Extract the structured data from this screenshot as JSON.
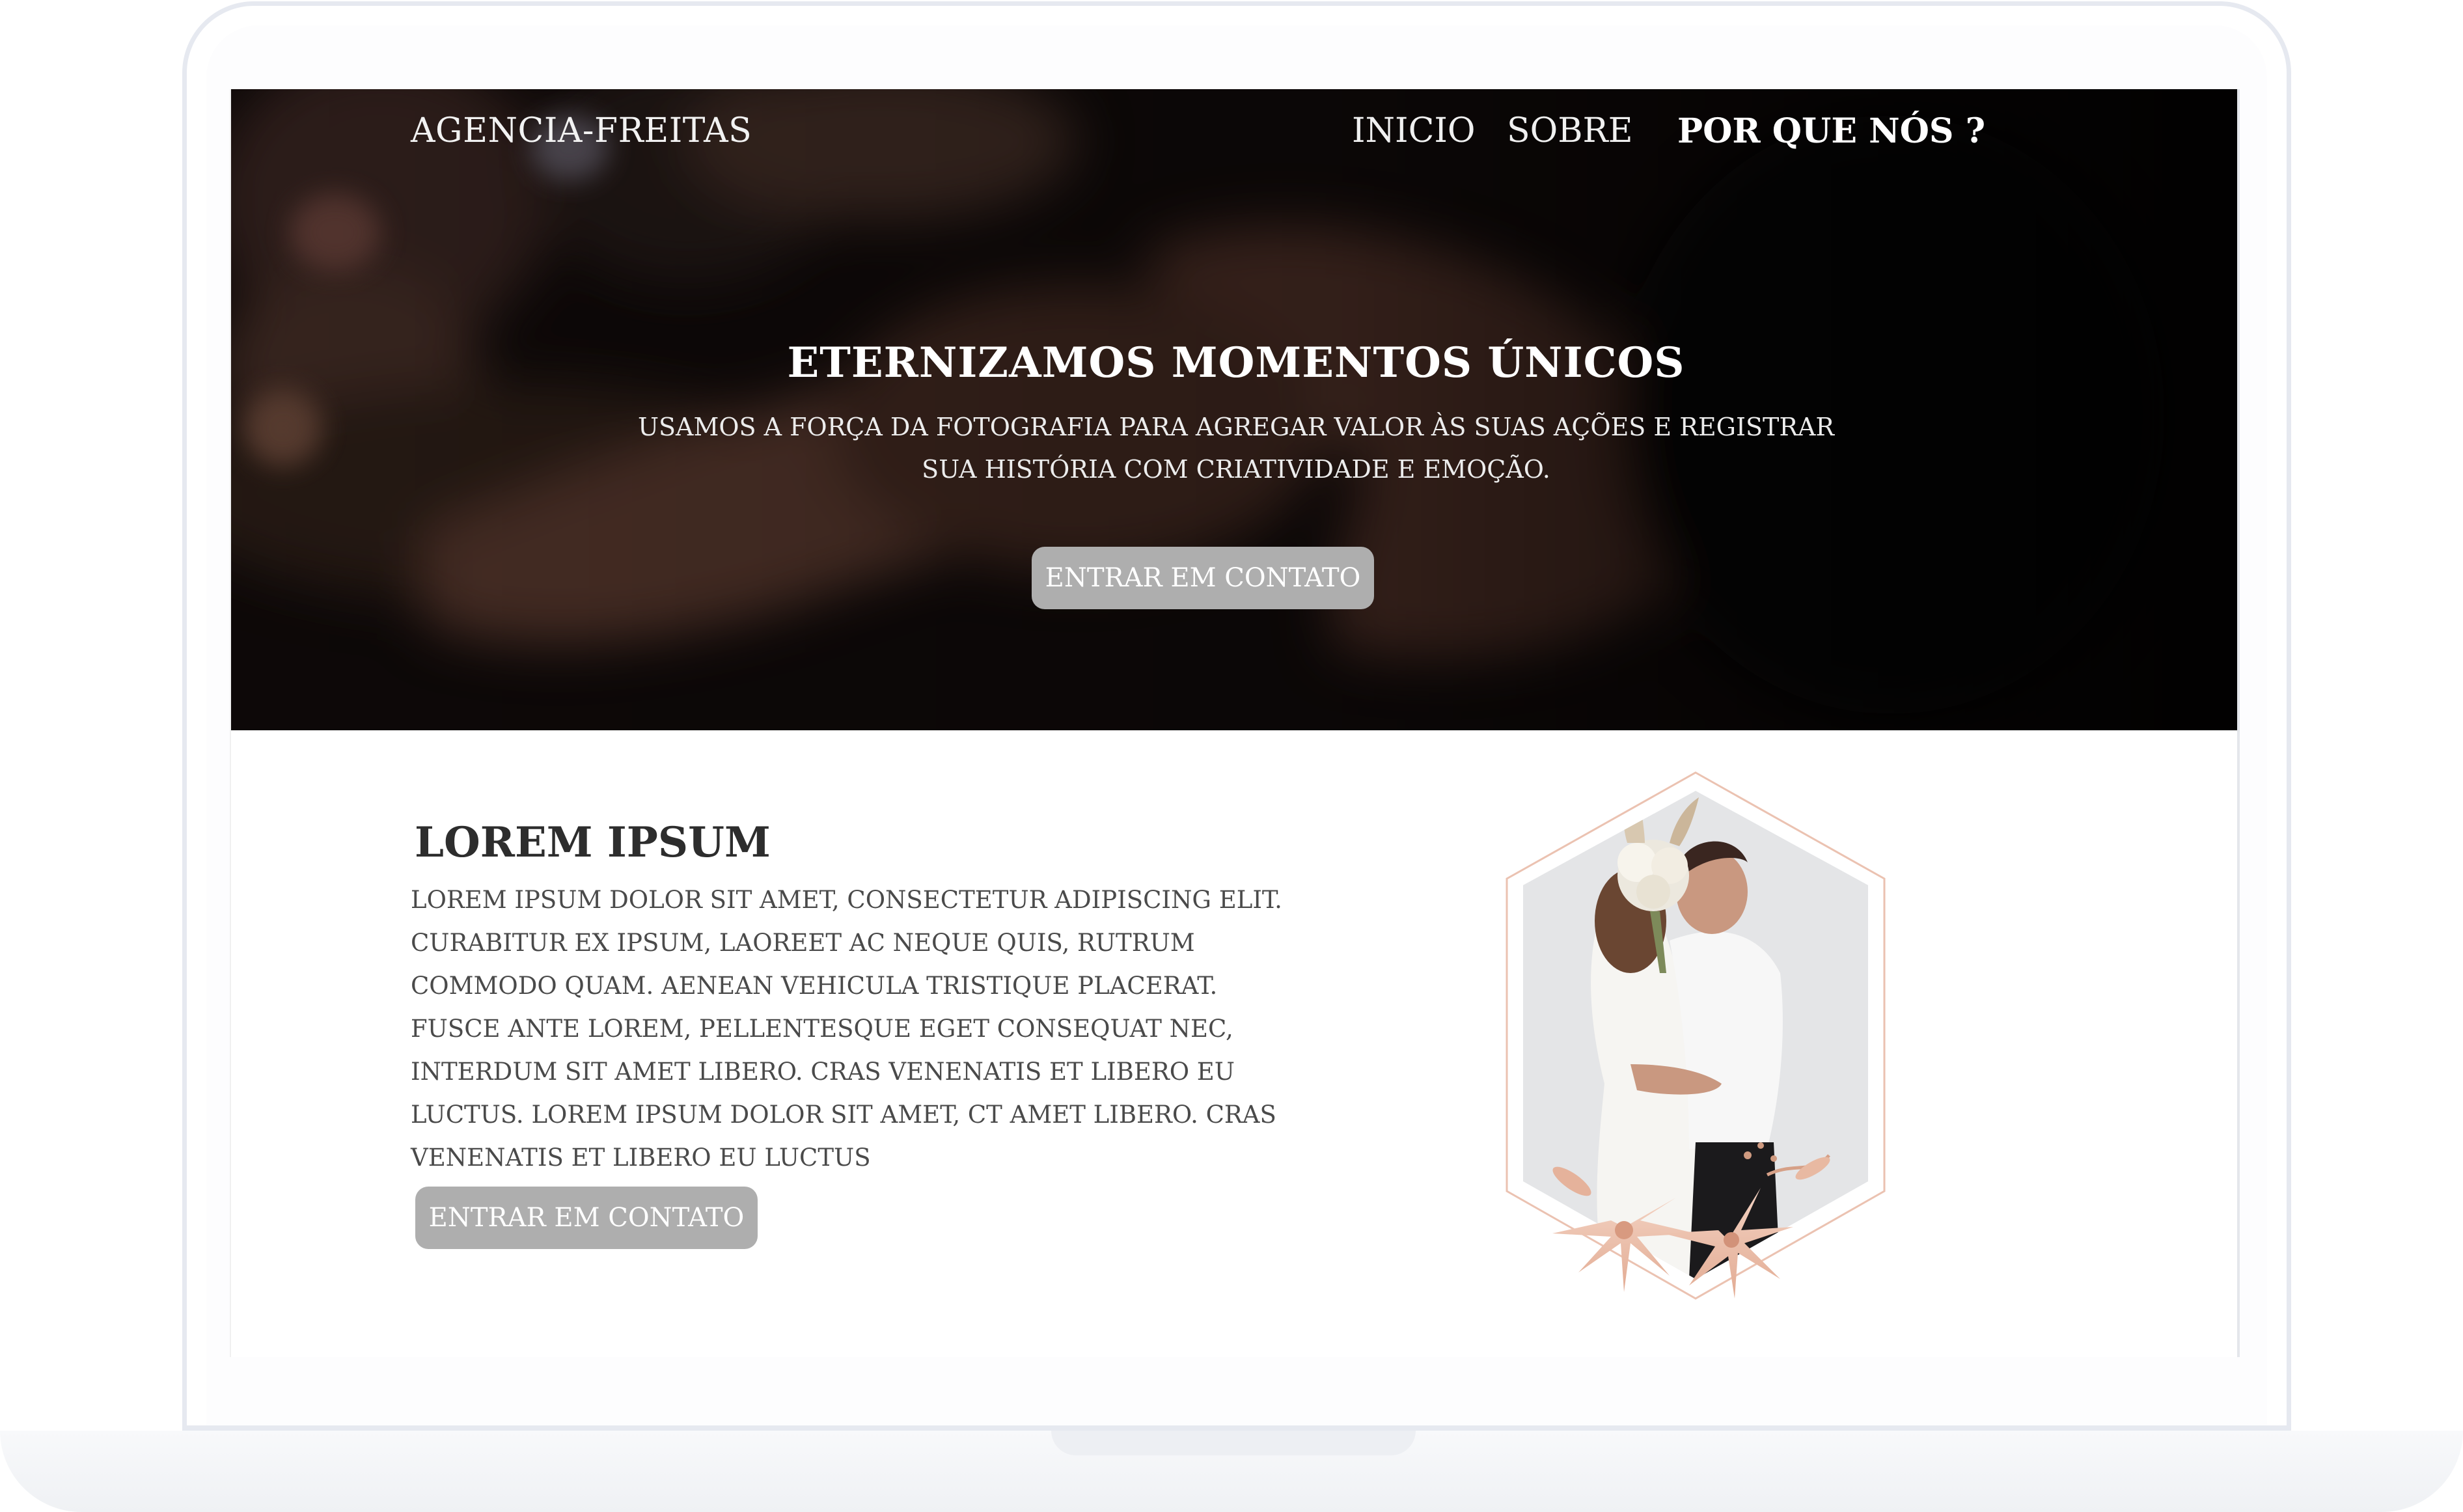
{
  "colors": {
    "hero_overlay": "#0a0706",
    "button_bg": "#aeaeae",
    "button_text": "#ffffff",
    "heading": "#2d2d2d",
    "body_text": "#4a4a4a",
    "accent_line": "#e8b9a6",
    "laptop_frame": "#e6e9f0"
  },
  "header": {
    "brand": "AGENCIA-FREITAS",
    "nav": [
      "INICIO",
      "SOBRE",
      "POR QUE NÓS ?"
    ]
  },
  "hero": {
    "title": "ETERNIZAMOS MOMENTOS ÚNICOS",
    "subtitle": "USAMOS A FORÇA DA FOTOGRAFIA PARA AGREGAR VALOR ÀS SUAS AÇÕES E REGISTRAR SUA HISTÓRIA COM CRIATIVIDADE E EMOÇÃO.",
    "button": "ENTRAR EM CONTATO"
  },
  "about": {
    "title": "LOREM IPSUM",
    "text": "LOREM IPSUM DOLOR SIT AMET, CONSECTETUR ADIPISCING ELIT. CURABITUR EX IPSUM, LAOREET AC NEQUE QUIS, RUTRUM COMMODO QUAM. AENEAN VEHICULA TRISTIQUE PLACERAT. FUSCE ANTE LOREM, PELLENTESQUE EGET CONSEQUAT NEC, INTERDUM SIT AMET LIBERO. CRAS VENENATIS ET LIBERO EU LUCTUS. LOREM IPSUM DOLOR SIT AMET, CT AMET LIBERO. CRAS VENENATIS ET LIBERO EU LUCTUS",
    "button": "ENTRAR EM CONTATO"
  },
  "icons": [
    "wedding-hero-photo",
    "couple-hexagon-photo",
    "paper-flowers-decoration"
  ]
}
